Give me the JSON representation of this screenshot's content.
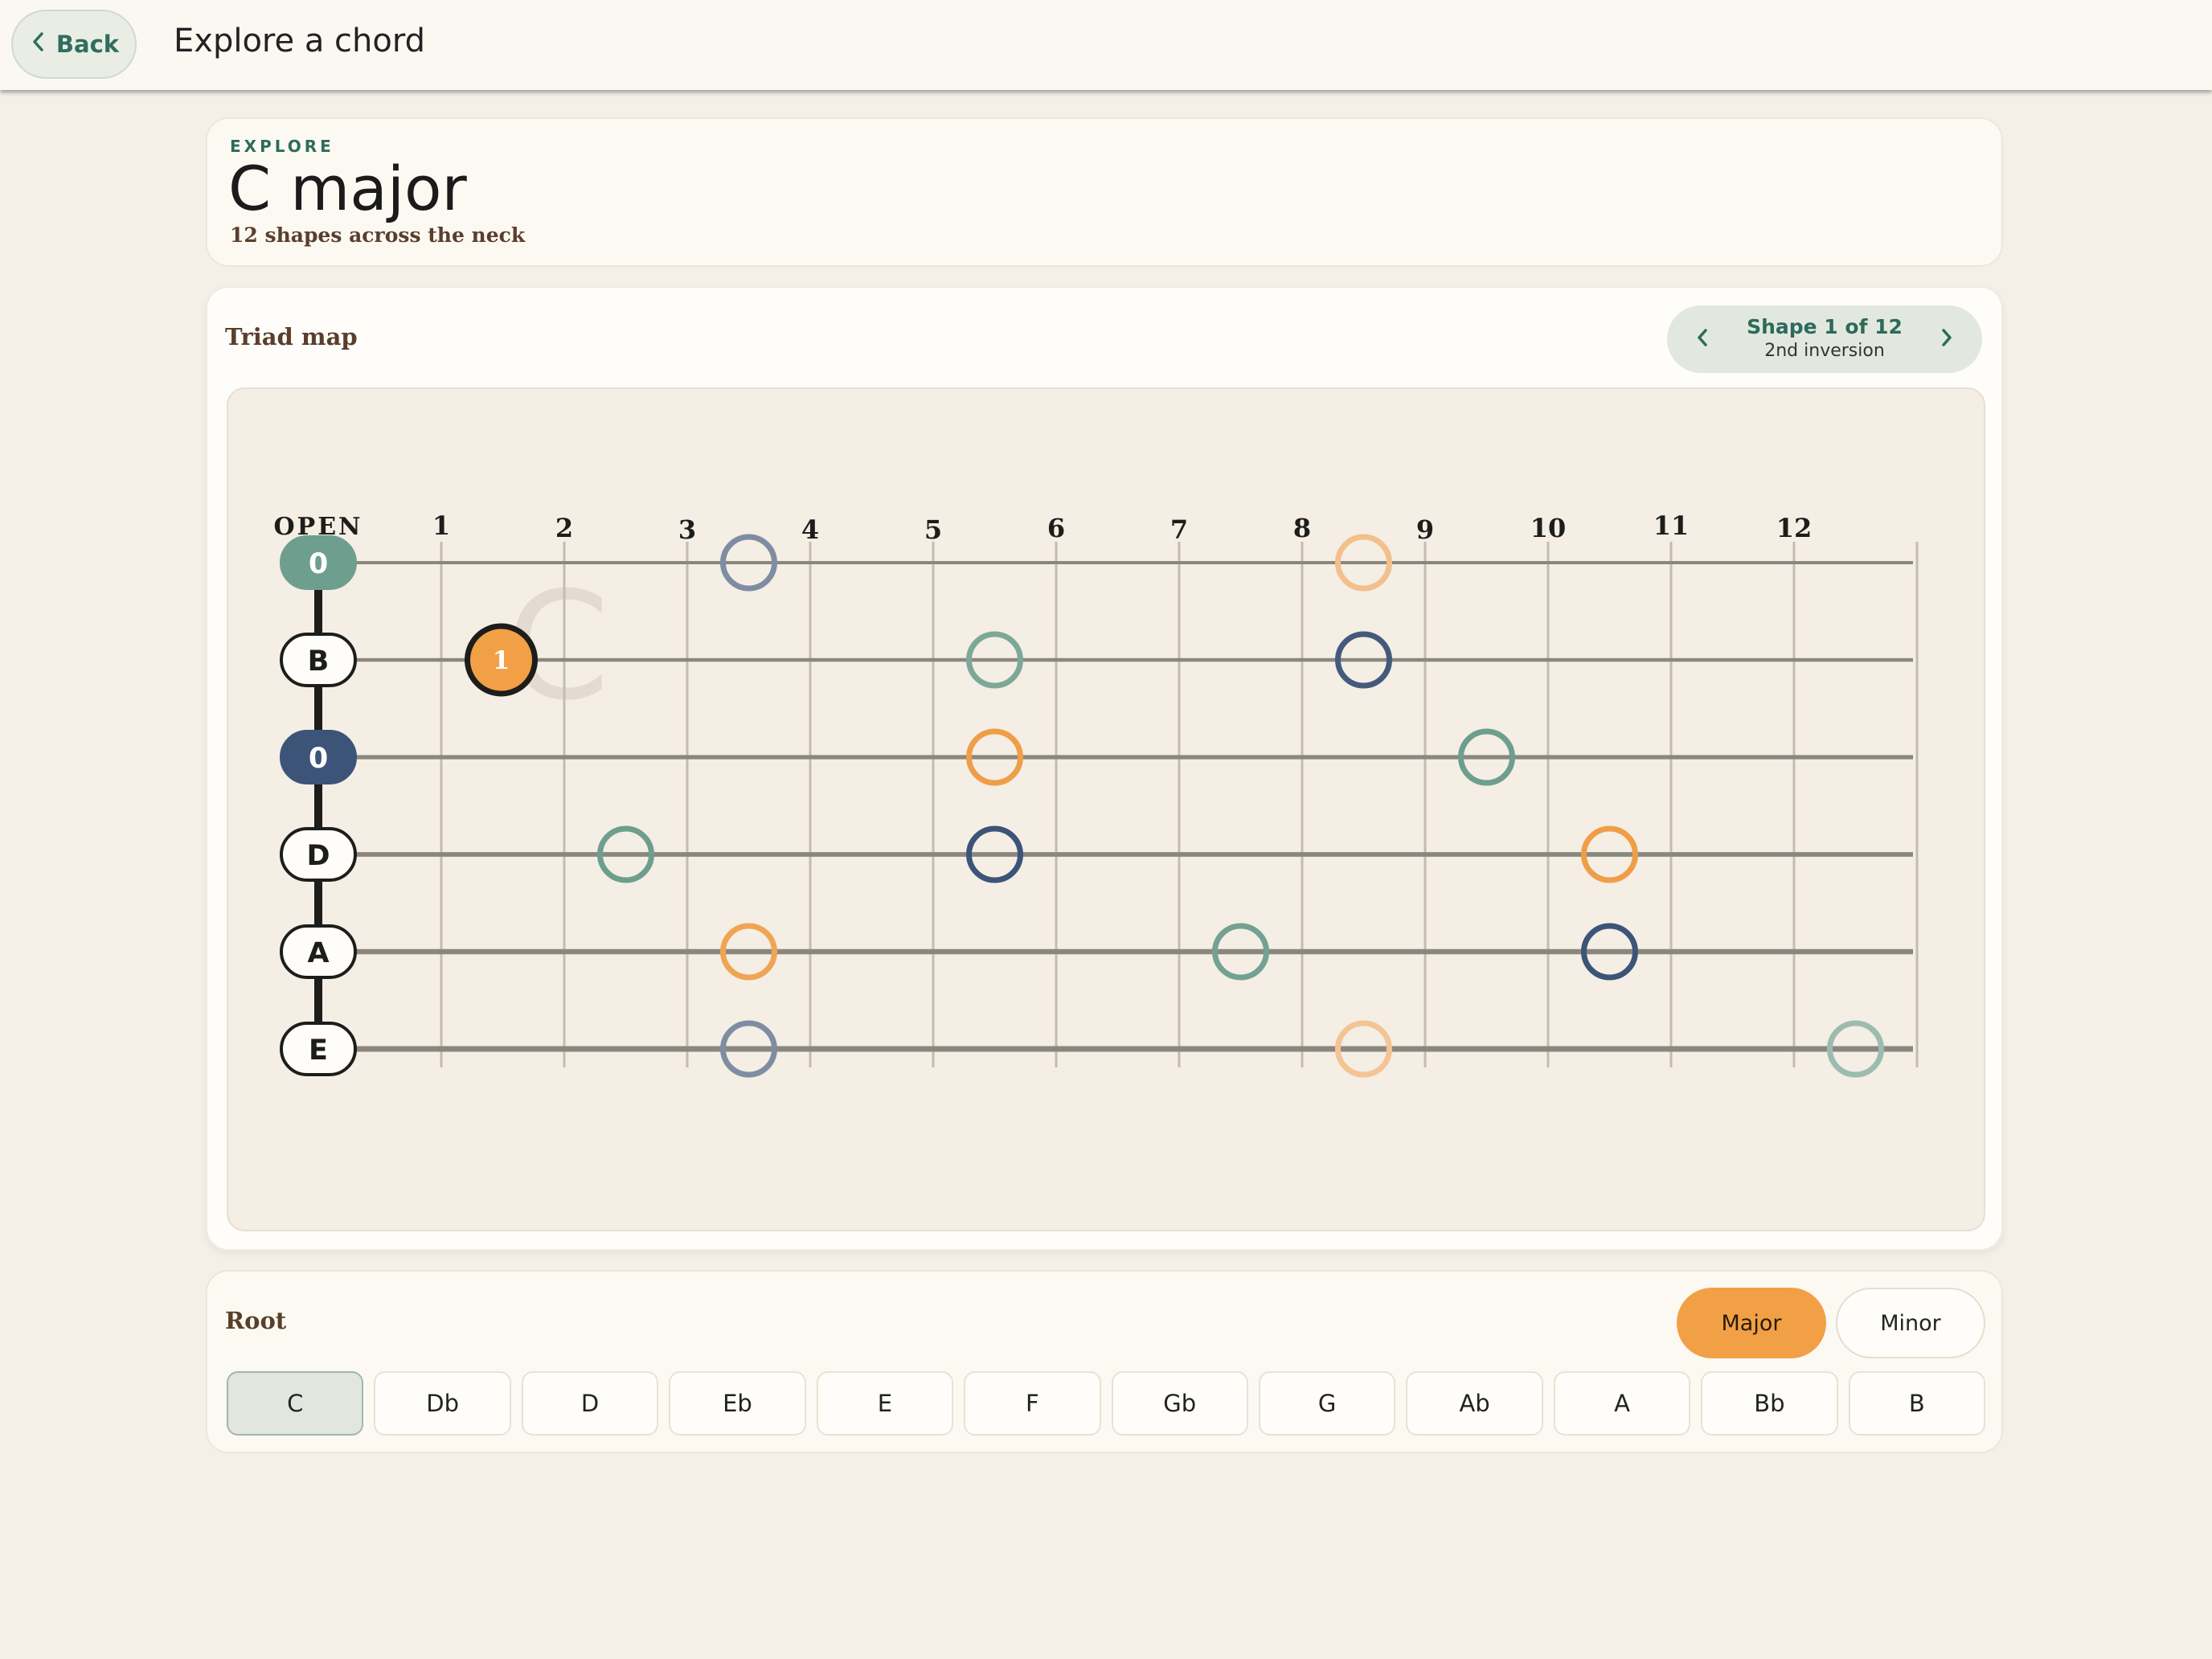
{
  "header": {
    "back_label": "Back",
    "title": "Explore a chord"
  },
  "hero": {
    "eyebrow": "EXPLORE",
    "title": "C major",
    "subtitle": "12 shapes across the neck"
  },
  "triad_map": {
    "label": "Triad map",
    "shape_nav": {
      "line1": "Shape 1 of 12",
      "line2": "2nd inversion"
    },
    "watermark": "C",
    "open_label": "OPEN",
    "fret_numbers": [
      "1",
      "2",
      "3",
      "4",
      "5",
      "6",
      "7",
      "8",
      "9",
      "10",
      "11",
      "12"
    ],
    "strings": [
      {
        "label": "0",
        "style": "teal"
      },
      {
        "label": "B",
        "style": "plain"
      },
      {
        "label": "0",
        "style": "navy"
      },
      {
        "label": "D",
        "style": "plain"
      },
      {
        "label": "A",
        "style": "plain"
      },
      {
        "label": "E",
        "style": "plain"
      }
    ],
    "colors": {
      "root": "#f2a046",
      "third": "#6e9e8e",
      "fifth": "#3c5478",
      "fret": "#c4bcb1",
      "string": "#8a877e"
    },
    "active_note": {
      "string": 1,
      "fret": 1,
      "label": "1"
    },
    "dots": [
      {
        "string": 0,
        "fret": 3,
        "color": "#7f8da3"
      },
      {
        "string": 0,
        "fret": 8,
        "color": "#f1c08c"
      },
      {
        "string": 1,
        "fret": 5,
        "color": "#7da898"
      },
      {
        "string": 1,
        "fret": 8,
        "color": "#445a7d"
      },
      {
        "string": 2,
        "fret": 5,
        "color": "#ef9e48"
      },
      {
        "string": 2,
        "fret": 9,
        "color": "#6e9e8e"
      },
      {
        "string": 3,
        "fret": 2,
        "color": "#6e9e8e"
      },
      {
        "string": 3,
        "fret": 5,
        "color": "#3c5478"
      },
      {
        "string": 3,
        "fret": 10,
        "color": "#ef9e48"
      },
      {
        "string": 4,
        "fret": 3,
        "color": "#f0a552"
      },
      {
        "string": 4,
        "fret": 7,
        "color": "#74a292"
      },
      {
        "string": 4,
        "fret": 10,
        "color": "#3c5478"
      },
      {
        "string": 5,
        "fret": 3,
        "color": "#7f8da3"
      },
      {
        "string": 5,
        "fret": 8,
        "color": "#f4c494"
      },
      {
        "string": 5,
        "fret": 12,
        "color": "#9cbcb0"
      }
    ]
  },
  "root_panel": {
    "label": "Root",
    "quality": {
      "major": "Major",
      "minor": "Minor",
      "selected": "Major"
    },
    "roots": [
      "C",
      "Db",
      "D",
      "Eb",
      "E",
      "F",
      "Gb",
      "G",
      "Ab",
      "A",
      "Bb",
      "B"
    ],
    "selected_root": "C"
  }
}
